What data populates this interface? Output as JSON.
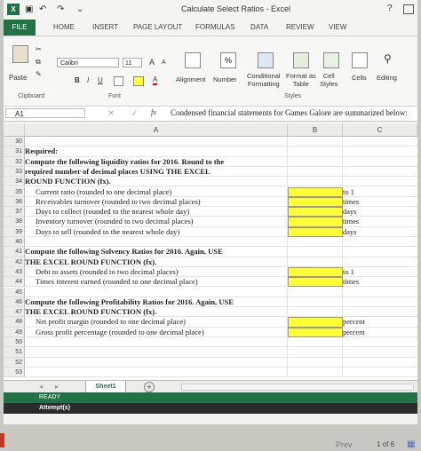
{
  "titlebar": {
    "logo": "X",
    "title": "Calculate Select Ratios - Excel",
    "help": "?"
  },
  "tabs": [
    "FILE",
    "HOME",
    "INSERT",
    "PAGE LAYOUT",
    "FORMULAS",
    "DATA",
    "REVIEW",
    "VIEW"
  ],
  "ribbon": {
    "paste": "Paste",
    "clipboard": "Clipboard",
    "font_name": "Calibri",
    "font_size": "11",
    "grow": "A",
    "shrink": "A",
    "bold": "B",
    "italic": "I",
    "underline": "U",
    "font_label": "Font",
    "alignment": "Alignment",
    "number": "Number",
    "percent": "%",
    "conditional": "Conditional",
    "formatting": "Formatting",
    "format_as": "Format as",
    "table": "Table",
    "cell": "Cell",
    "styles_btn": "Styles",
    "styles_label": "Styles",
    "cells": "Cells",
    "editing": "Editing"
  },
  "formula_bar": {
    "name_box": "A1",
    "fx": "fx",
    "content": "Condensed financial statements for Games Galore are summarized below:"
  },
  "columns": [
    "A",
    "B",
    "C"
  ],
  "rows": [
    {
      "n": "30",
      "a": "",
      "b": "",
      "c": "",
      "yellow": false,
      "bold": false,
      "indent": false
    },
    {
      "n": "31",
      "a": "Required:",
      "b": "",
      "c": "",
      "yellow": false,
      "bold": true,
      "indent": false
    },
    {
      "n": "32",
      "a": "Compute the following liquidity ratios for 2016. Round to the",
      "b": "",
      "c": "",
      "yellow": false,
      "bold": true,
      "indent": false
    },
    {
      "n": "33",
      "a": "required number of decimal places USING THE EXCEL",
      "b": "",
      "c": "",
      "yellow": false,
      "bold": true,
      "indent": false
    },
    {
      "n": "34",
      "a": "ROUND FUNCTION (fx).",
      "b": "",
      "c": "",
      "yellow": false,
      "bold": true,
      "indent": false
    },
    {
      "n": "35",
      "a": "Current ratio (rounded to one decimal place)",
      "b": "",
      "c": "to 1",
      "yellow": true,
      "bold": false,
      "indent": true
    },
    {
      "n": "36",
      "a": "Receivables turnover (rounded to two decimal places)",
      "b": "",
      "c": "times",
      "yellow": true,
      "bold": false,
      "indent": true
    },
    {
      "n": "37",
      "a": "Days to collect (rounded to the nearest whole day)",
      "b": "",
      "c": "days",
      "yellow": true,
      "bold": false,
      "indent": true
    },
    {
      "n": "38",
      "a": "Inventory turnover (rounded to two decimal places)",
      "b": "",
      "c": "times",
      "yellow": true,
      "bold": false,
      "indent": true
    },
    {
      "n": "39",
      "a": "Days to sell (rounded to the nearest whole day)",
      "b": "",
      "c": "days",
      "yellow": true,
      "bold": false,
      "indent": true
    },
    {
      "n": "40",
      "a": "",
      "b": "",
      "c": "",
      "yellow": false,
      "bold": false,
      "indent": false
    },
    {
      "n": "41",
      "a": "Compute the following Solvency Ratios for 2016. Again, USE",
      "b": "",
      "c": "",
      "yellow": false,
      "bold": true,
      "indent": false
    },
    {
      "n": "42",
      "a": "THE EXCEL ROUND FUNCTION (fx).",
      "b": "",
      "c": "",
      "yellow": false,
      "bold": true,
      "indent": false
    },
    {
      "n": "43",
      "a": "Debt to assets (rounded to two decimal places)",
      "b": "",
      "c": "to 1",
      "yellow": true,
      "bold": false,
      "indent": true
    },
    {
      "n": "44",
      "a": "Times interest earned (rounded to one decimal place)",
      "b": "",
      "c": "times",
      "yellow": true,
      "bold": false,
      "indent": true
    },
    {
      "n": "45",
      "a": "",
      "b": "",
      "c": "",
      "yellow": false,
      "bold": false,
      "indent": false
    },
    {
      "n": "46",
      "a": "Compute the following Profitability Ratios for 2016. Again, USE",
      "b": "",
      "c": "",
      "yellow": false,
      "bold": true,
      "indent": false
    },
    {
      "n": "47",
      "a": "THE EXCEL ROUND FUNCTION (fx).",
      "b": "",
      "c": "",
      "yellow": false,
      "bold": true,
      "indent": false
    },
    {
      "n": "48",
      "a": "Net profit margin (rounded to one decimal place)",
      "b": "",
      "c": "percent",
      "yellow": true,
      "bold": false,
      "indent": true
    },
    {
      "n": "49",
      "a": "Gross profit percentage (rounded to one decimal place)",
      "b": "",
      "c": "percent",
      "yellow": true,
      "bold": false,
      "indent": true
    },
    {
      "n": "50",
      "a": "",
      "b": "",
      "c": "",
      "yellow": false,
      "bold": false,
      "indent": false
    },
    {
      "n": "51",
      "a": "",
      "b": "",
      "c": "",
      "yellow": false,
      "bold": false,
      "indent": false
    },
    {
      "n": "52",
      "a": "",
      "b": "",
      "c": "",
      "yellow": false,
      "bold": false,
      "indent": false
    },
    {
      "n": "53",
      "a": "",
      "b": "",
      "c": "",
      "yellow": false,
      "bold": false,
      "indent": false
    }
  ],
  "sheet_tab": "Sheet1",
  "add_sheet": "+",
  "status": "READY",
  "attempt": "Attempt(s)",
  "pager": {
    "prev": "Prev",
    "page": "1",
    "of": "of",
    "total": "6"
  },
  "colors": {
    "excel_green": "#217346",
    "input_yellow": "#ffff33"
  }
}
